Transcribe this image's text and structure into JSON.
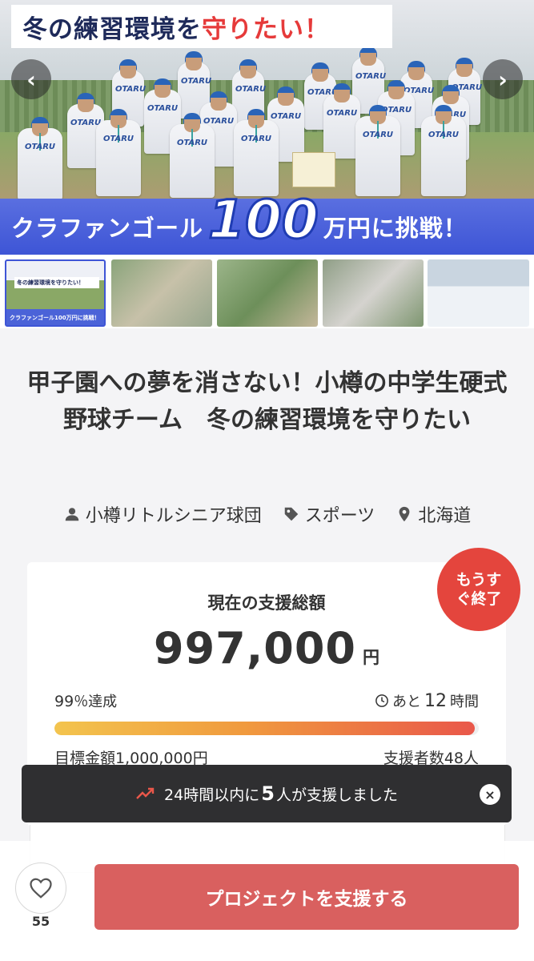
{
  "hero": {
    "title_main": "冬の練習環境を",
    "title_accent": "守りたい！",
    "banner_prefix": "クラファンゴール",
    "banner_number": "100",
    "banner_suffix": "万円に挑戦！",
    "jersey_text": "OTARU",
    "prev_arrow": "‹",
    "next_arrow": "›"
  },
  "thumbnails": {
    "t1_title": "冬の練習環境を守りたい！",
    "t1_banner": "クラファンゴール100万円に挑戦！"
  },
  "project": {
    "title": "甲子園への夢を消さない！小樽の中学生硬式野球チーム　冬の練習環境を守りたい",
    "owner": "小樽リトルシニア球団",
    "category": "スポーツ",
    "region": "北海道"
  },
  "funding": {
    "badge": "もうすぐ終了",
    "label": "現在の支援総額",
    "amount": "997,000",
    "unit": "円",
    "percent": "99",
    "percent_suffix": "％達成",
    "progress_fraction": 0.99,
    "time_prefix": "あと",
    "time_value": "12",
    "time_unit": "時間",
    "goal": "目標金額1,000,000円",
    "supporters": "支援者数48人"
  },
  "toast": {
    "prefix": "24時間以内に",
    "count": "5",
    "suffix": "人が支援しました",
    "close": "×"
  },
  "bottom": {
    "favorite_count": "55",
    "support_button": "プロジェクトを支援する"
  },
  "colors": {
    "brand_blue": "#3e55d6",
    "badge_red": "#e4453d",
    "button_red": "#d9605f",
    "toast_bg": "#2f2f31"
  }
}
